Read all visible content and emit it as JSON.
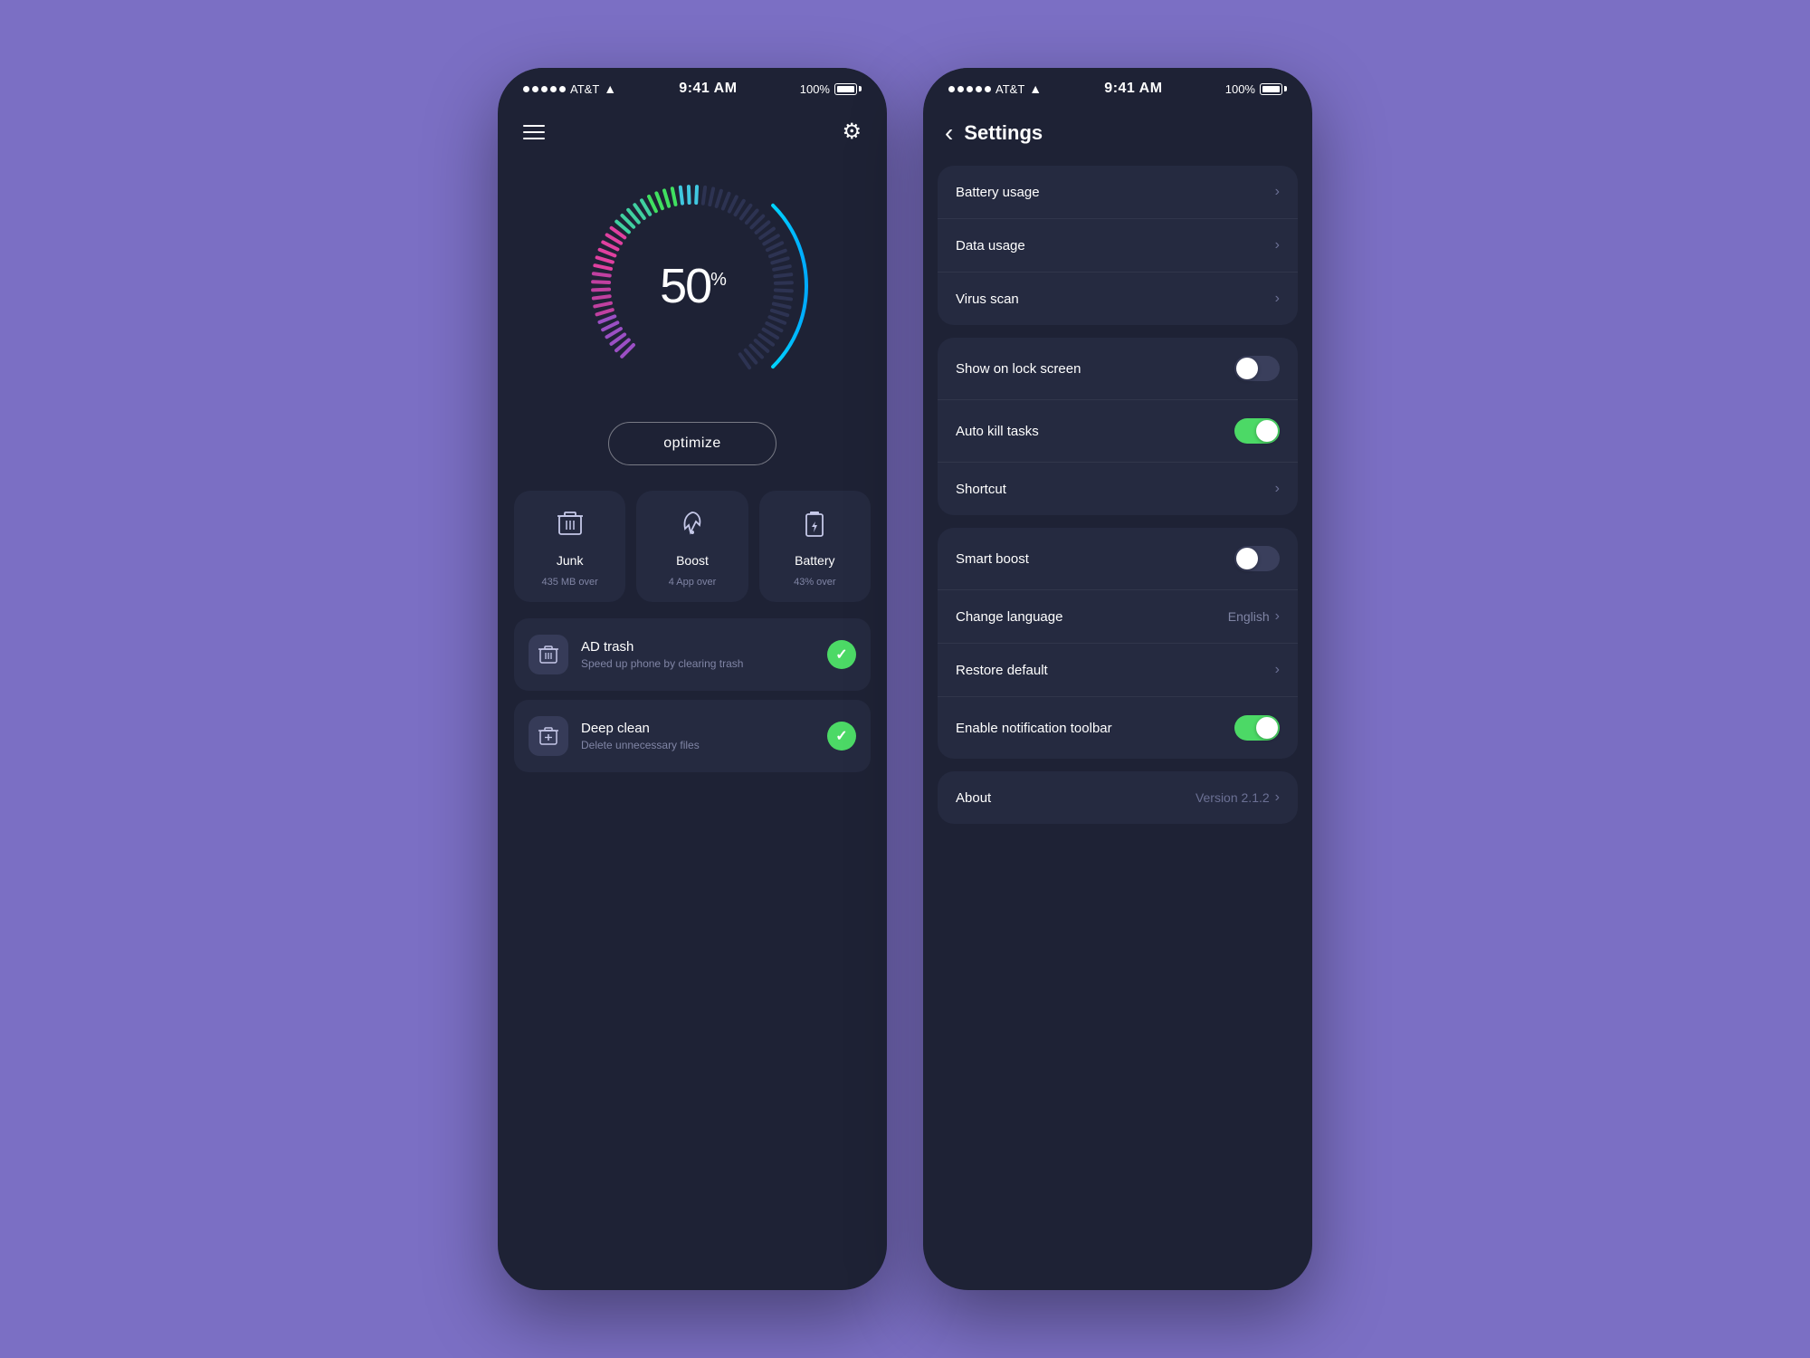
{
  "page": {
    "background": "#7b6fc4"
  },
  "phone1": {
    "status": {
      "carrier": "AT&T",
      "time": "9:41 AM",
      "battery": "100%"
    },
    "header": {
      "menu_icon": "≡",
      "settings_icon": "⚙"
    },
    "gauge": {
      "percent": "50",
      "percent_symbol": "%",
      "value": 50
    },
    "optimize_button": "optimize",
    "tiles": [
      {
        "icon": "🗑",
        "label": "Junk",
        "sub": "435 MB over"
      },
      {
        "icon": "🚀",
        "label": "Boost",
        "sub": "4 App over"
      },
      {
        "icon": "🔋",
        "label": "Battery",
        "sub": "43% over"
      }
    ],
    "list_items": [
      {
        "icon": "🗑",
        "title": "AD trash",
        "subtitle": "Speed up phone by clearing trash",
        "checked": true
      },
      {
        "icon": "⬇",
        "title": "Deep clean",
        "subtitle": "Delete unnecessary files",
        "checked": true
      }
    ]
  },
  "phone2": {
    "status": {
      "carrier": "AT&T",
      "time": "9:41 AM",
      "battery": "100%"
    },
    "header": {
      "back_icon": "‹",
      "title": "Settings"
    },
    "groups": [
      {
        "id": "group1",
        "rows": [
          {
            "label": "Battery usage",
            "type": "chevron"
          },
          {
            "label": "Data usage",
            "type": "chevron"
          },
          {
            "label": "Virus scan",
            "type": "chevron"
          }
        ]
      },
      {
        "id": "group2",
        "rows": [
          {
            "label": "Show on lock screen",
            "type": "toggle",
            "on": false
          },
          {
            "label": "Auto kill tasks",
            "type": "toggle",
            "on": true
          },
          {
            "label": "Shortcut",
            "type": "chevron"
          }
        ]
      },
      {
        "id": "group3",
        "rows": [
          {
            "label": "Smart boost",
            "type": "toggle",
            "on": false
          },
          {
            "label": "Change language",
            "type": "chevron",
            "value": "English"
          },
          {
            "label": "Restore default",
            "type": "chevron"
          },
          {
            "label": "Enable notification toolbar",
            "type": "toggle",
            "on": true
          }
        ]
      },
      {
        "id": "group4",
        "rows": [
          {
            "label": "About",
            "type": "version",
            "value": "Version 2.1.2"
          }
        ]
      }
    ]
  }
}
